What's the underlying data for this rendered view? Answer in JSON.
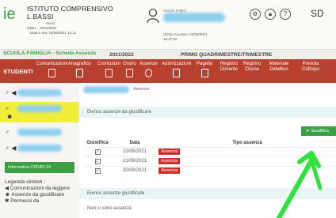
{
  "header": {
    "school_line1": "ISTITUTO COMPRENSIVO",
    "school_line2": "L.BASSI",
    "school_meta1": "Anno:",
    "school_meta2": "S30H... 2021/2022",
    "school_meta3": "Data e ora: 23/09/2021 14:11",
    "user_label": "Gentile (Figlio)",
    "last_access_label": "Ultimo Accesso: 23/09/2021",
    "last_access_time": "15:47:32",
    "brand": "SD"
  },
  "title_strip": {
    "app_name": "SCUOLA-FAMIGLIA - Scheda Assenze",
    "year": "2021/2022",
    "period": "PRIMO QUADRIMESTRE/TRIMESTRE"
  },
  "nav": {
    "students_label": "STUDENTI",
    "items": [
      {
        "label": "Comunicazioni"
      },
      {
        "label": "Anagrafico"
      },
      {
        "label": "Curriculum"
      },
      {
        "label": "Orario"
      },
      {
        "label": "Assenze"
      },
      {
        "label": "Autorizzazioni"
      },
      {
        "label": "Pagella"
      },
      {
        "label": "Registro Docente"
      },
      {
        "label": "Registro Classe"
      },
      {
        "label": "Materiale Didattico"
      },
      {
        "label": "Prenota Colloqui"
      }
    ]
  },
  "sidebar": {
    "covid_button": "Informativa COVID-19",
    "legend_title": "Legenda simboli :",
    "legend_items": [
      "Comunicazioni da leggere",
      "Assenze da giustificare",
      "Permessi da"
    ]
  },
  "main": {
    "breadcrumb": "Assenze",
    "panel1_title": "Elenco assenze da giustificare",
    "justify_button": "Giustifica",
    "columns": {
      "giustifica": "Giustifica",
      "data": "Data",
      "tipo": "Tipo assenza"
    },
    "rows": [
      {
        "date": "22/09/2021",
        "type": "Assenza"
      },
      {
        "date": "21/09/2021",
        "type": "Assenza"
      },
      {
        "date": "20/09/2021",
        "type": "Assenza"
      }
    ],
    "panel2_title": "Elenco assenze giustificate",
    "no_absences": "Non ci sono assenze."
  },
  "colors": {
    "nav_bg": "#b8402e",
    "accent_green": "#3aa043",
    "absence_red": "#c9302c",
    "highlight_yellow": "#f0ee3a"
  }
}
